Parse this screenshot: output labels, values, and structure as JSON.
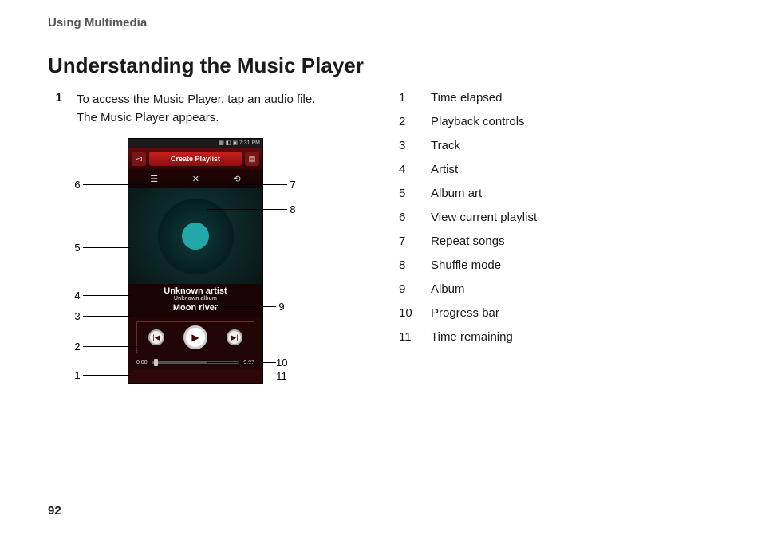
{
  "header": "Using Multimedia",
  "title": "Understanding the Music Player",
  "step": {
    "num": "1",
    "text_a": "To access the Music Player, tap an audio file.",
    "text_b": "The Music Player appears."
  },
  "phone": {
    "status_time": "7:31 PM",
    "create_playlist": "Create Playlist",
    "artist": "Unknown artist",
    "album": "Unknown album",
    "track": "Moon river",
    "time_elapsed": "0:00",
    "time_remaining": "0:07"
  },
  "callouts": {
    "c1": "1",
    "c2": "2",
    "c3": "3",
    "c4": "4",
    "c5": "5",
    "c6": "6",
    "c7": "7",
    "c8": "8",
    "c9": "9",
    "c10": "10",
    "c11": "11"
  },
  "legend": [
    {
      "num": "1",
      "label": "Time elapsed"
    },
    {
      "num": "2",
      "label": "Playback controls"
    },
    {
      "num": "3",
      "label": "Track"
    },
    {
      "num": "4",
      "label": "Artist"
    },
    {
      "num": "5",
      "label": "Album art"
    },
    {
      "num": "6",
      "label": "View current playlist"
    },
    {
      "num": "7",
      "label": "Repeat songs"
    },
    {
      "num": "8",
      "label": "Shuffle mode"
    },
    {
      "num": "9",
      "label": "Album"
    },
    {
      "num": "10",
      "label": "Progress bar"
    },
    {
      "num": "11",
      "label": "Time remaining"
    }
  ],
  "page_number": "92"
}
